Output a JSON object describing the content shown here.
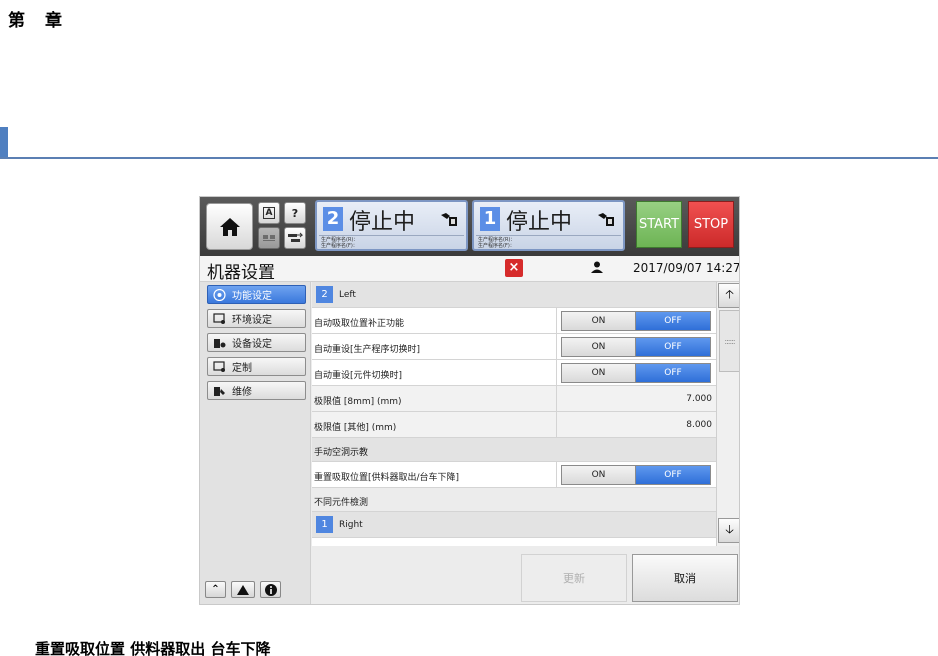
{
  "document": {
    "chapter_left": "第",
    "chapter_right": "章",
    "caption": "重置吸取位置  供料器取出 台车下降"
  },
  "topbar": {
    "small_btn_a": "A",
    "small_btn_help": "?",
    "lane2": {
      "num": "2",
      "state": "停止中",
      "prog_r": "生产程序名(R)：",
      "prog_f": "生产程序名(F)："
    },
    "lane1": {
      "num": "1",
      "state": "停止中",
      "prog_r": "生产程序名(R)：",
      "prog_f": "生产程序名(F)："
    },
    "start": "START",
    "stop": "STOP"
  },
  "titlebar": {
    "title": "机器设置",
    "close": "×",
    "datetime": "2017/09/07 14:27"
  },
  "sidebar": {
    "items": [
      {
        "label": "功能设定",
        "active": true
      },
      {
        "label": "环境设定",
        "active": false
      },
      {
        "label": "设备设定",
        "active": false
      },
      {
        "label": "定制",
        "active": false
      },
      {
        "label": "维修",
        "active": false
      }
    ]
  },
  "content": {
    "lane_left": {
      "num": "2",
      "name": "Left"
    },
    "rows": {
      "r1": "自动吸取位置补正功能",
      "r2": "自动重设[生产程序切换时]",
      "r3": "自动重设[元件切换时]",
      "r4": "极限值 [8mm] (mm)",
      "r4_value": "7.000",
      "r5": "极限值 [其他] (mm)",
      "r5_value": "8.000",
      "h1": "手动空洞示教",
      "r6": "重置吸取位置[供料器取出/台车下降]",
      "h2": "不同元件檢測"
    },
    "lane_right": {
      "num": "1",
      "name": "Right"
    },
    "on_label": "ON",
    "off_label": "OFF"
  },
  "footer": {
    "update": "更新",
    "cancel": "取消"
  },
  "colors": {
    "accent_blue": "#3a78dc",
    "start_green": "#6db454",
    "stop_red": "#cc2a2a"
  }
}
